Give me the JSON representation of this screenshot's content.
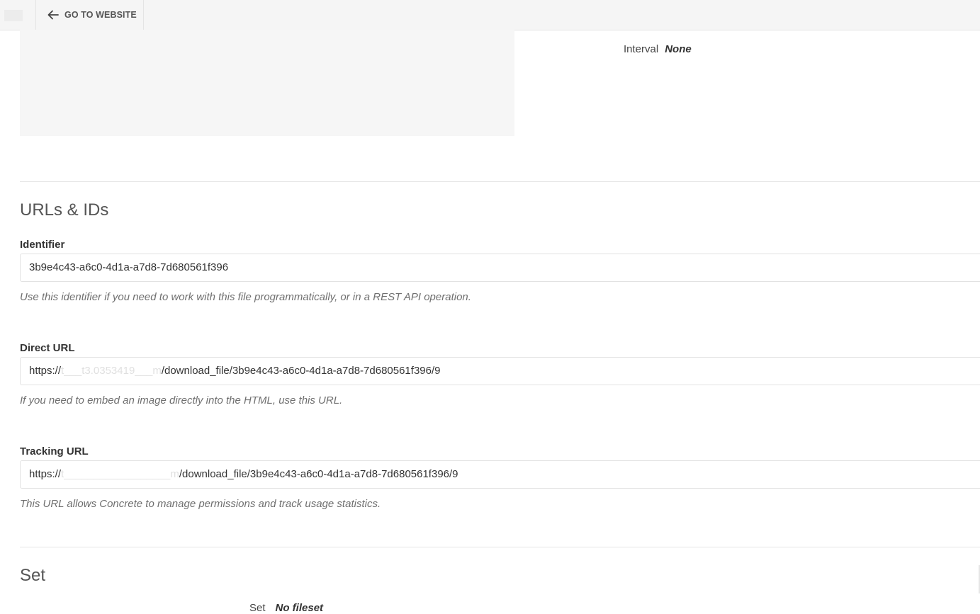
{
  "topbar": {
    "go_to_website": "GO TO WEBSITE"
  },
  "schedule": {
    "interval_label": "Interval",
    "interval_value": "None"
  },
  "urls_section": {
    "title": "URLs & IDs",
    "identifier": {
      "label": "Identifier",
      "value": "3b9e4c43-a6c0-4d1a-a7d8-7d680561f396",
      "help": "Use this identifier if you need to work with this file programmatically, or in a REST API operation."
    },
    "direct_url": {
      "label": "Direct URL",
      "value_prefix": "https://",
      "value_redacted": "t___t3.0353419___m",
      "value_suffix": "/download_file/3b9e4c43-a6c0-4d1a-a7d8-7d680561f396/9",
      "help": "If you need to embed an image directly into the HTML, use this URL."
    },
    "tracking_url": {
      "label": "Tracking URL",
      "value_prefix": "https://",
      "value_redacted": "t__________________m",
      "value_suffix": "/download_file/3b9e4c43-a6c0-4d1a-a7d8-7d680561f396/9",
      "help": "This URL allows Concrete to manage permissions and track usage statistics."
    }
  },
  "set_section": {
    "title": "Set",
    "set_label": "Set",
    "set_value": "No fileset"
  },
  "icons": {
    "back": "arrow-left-icon"
  }
}
